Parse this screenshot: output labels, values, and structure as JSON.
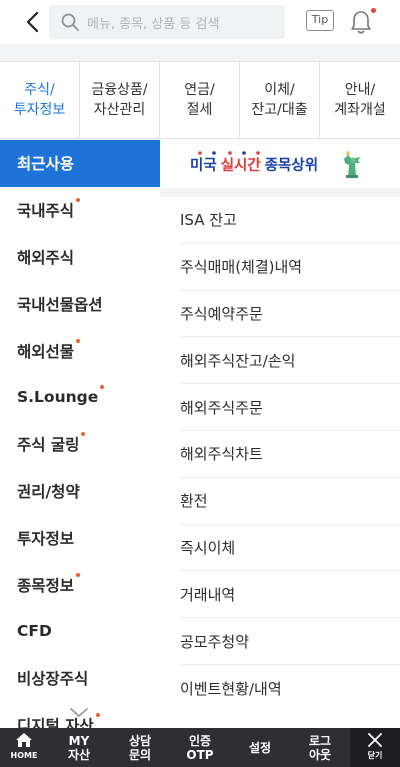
{
  "header": {
    "search_placeholder": "메뉴, 종목, 상품 등 검색",
    "tip_label": "Tip"
  },
  "tabs": [
    {
      "label": "주식/\n투자정보",
      "active": true
    },
    {
      "label": "금융상품/\n자산관리",
      "active": false
    },
    {
      "label": "연금/\n절세",
      "active": false
    },
    {
      "label": "이체/\n잔고/대출",
      "active": false
    },
    {
      "label": "안내/\n계좌개설",
      "active": false
    }
  ],
  "sidebar": {
    "items": [
      {
        "label": "최근사용",
        "active": true,
        "dot": false
      },
      {
        "label": "국내주식",
        "active": false,
        "dot": true
      },
      {
        "label": "해외주식",
        "active": false,
        "dot": false
      },
      {
        "label": "국내선물옵션",
        "active": false,
        "dot": false
      },
      {
        "label": "해외선물",
        "active": false,
        "dot": true
      },
      {
        "label": "S.Lounge",
        "active": false,
        "dot": true
      },
      {
        "label": "주식 굴링",
        "active": false,
        "dot": true
      },
      {
        "label": "권리/청약",
        "active": false,
        "dot": false
      },
      {
        "label": "투자정보",
        "active": false,
        "dot": false
      },
      {
        "label": "종목정보",
        "active": false,
        "dot": true
      },
      {
        "label": "CFD",
        "active": false,
        "dot": false
      },
      {
        "label": "비상장주식",
        "active": false,
        "dot": false
      },
      {
        "label": "디지털 자산",
        "active": false,
        "dot": true
      }
    ]
  },
  "banner": {
    "part1": "미국",
    "part2": "실시간",
    "part3": "종목상위"
  },
  "recent": {
    "items": [
      "ISA 잔고",
      "주식매매(체결)내역",
      "주식예약주문",
      "해외주식잔고/손익",
      "해외주식주문",
      "해외주식차트",
      "환전",
      "즉시이체",
      "거래내역",
      "공모주청약",
      "이벤트현황/내역"
    ]
  },
  "bottom_bar": {
    "home": "HOME",
    "my_assets": "MY\n자산",
    "consult": "상담\n문의",
    "otp": "인증\nOTP",
    "settings": "설정",
    "logout": "로그\n아웃",
    "close": "닫기"
  },
  "colors": {
    "accent": "#1e73d8",
    "bottom_bar": "#2f2f33",
    "badge_dot": "#f0602a"
  }
}
